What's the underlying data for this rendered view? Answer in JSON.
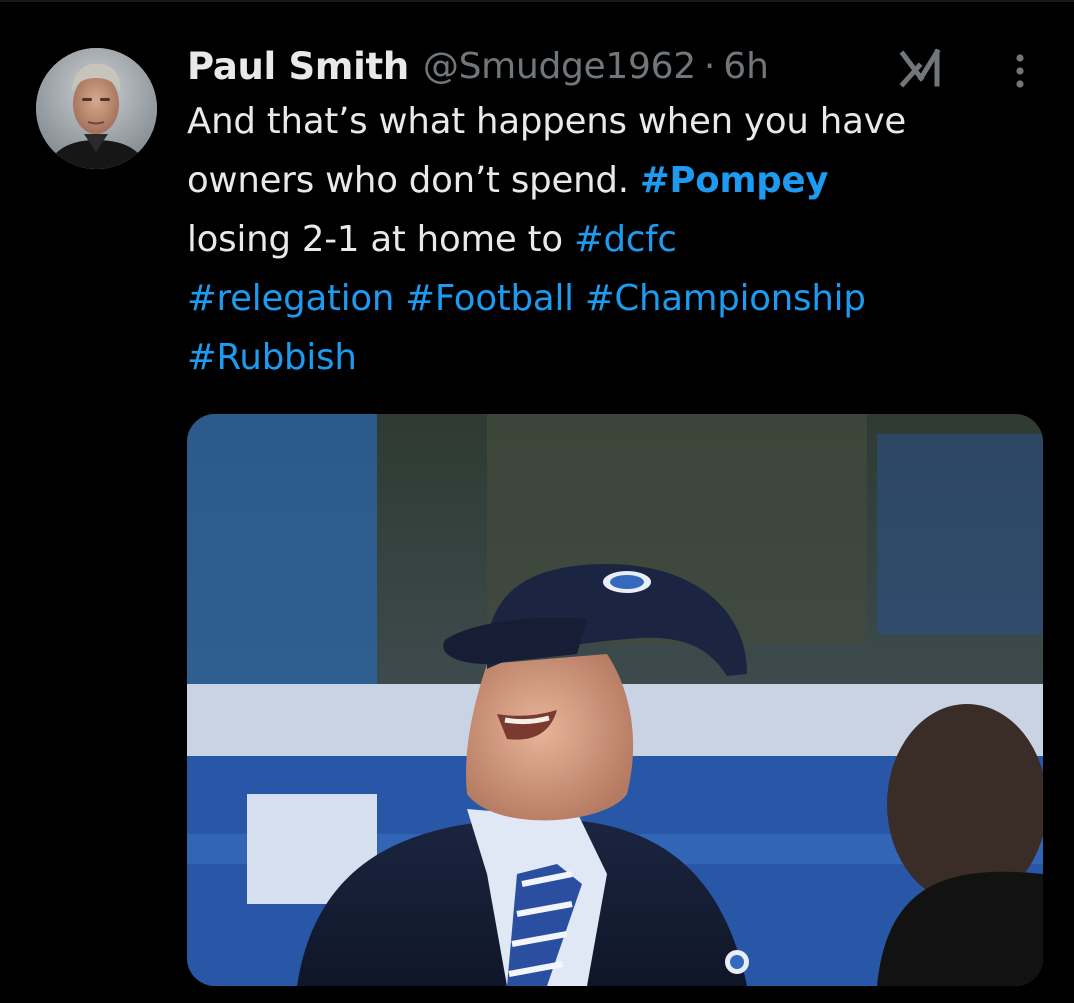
{
  "tweet": {
    "author": {
      "display_name": "Paul Smith",
      "handle": "@Smudge1962",
      "avatar_icon": "profile-photo"
    },
    "separator": "·",
    "time": "6h",
    "actions": {
      "grok_icon": "grok-icon",
      "more_icon": "more-vertical-icon"
    },
    "text": {
      "line1": "And that’s what happens when you have",
      "line2_text": "owners who don’t spend. ",
      "line2_tag": "#Pompey",
      "line3_text": "losing 2-1 at home to ",
      "line3_tag": "#dcfc",
      "line4_tags": [
        "#relegation",
        "#Football",
        "#Championship"
      ],
      "line5_tag": "#Rubbish"
    },
    "media": {
      "kind": "photo"
    }
  },
  "colors": {
    "background": "#000000",
    "text": "#e7e9ea",
    "secondary": "#71767b",
    "link": "#1d9bf0"
  }
}
